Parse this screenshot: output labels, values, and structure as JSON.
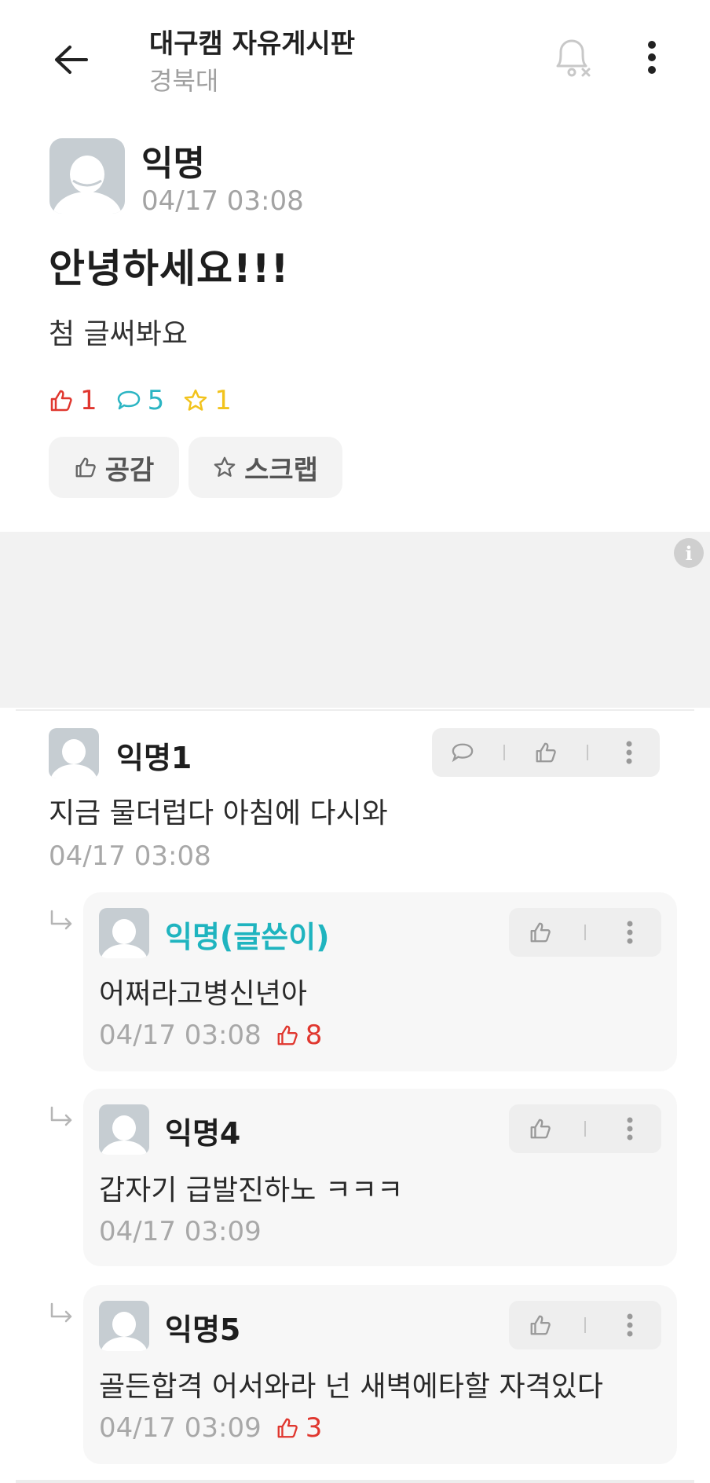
{
  "header": {
    "board_title": "대구캠 자유게시판",
    "school": "경북대"
  },
  "post": {
    "author": "익명",
    "time": "04/17 03:08",
    "title": "안녕하세요!!!",
    "body": "첨 글써봐요",
    "stats": {
      "likes": "1",
      "comments": "5",
      "scraps": "1"
    },
    "like_button_label": "공감",
    "scrap_button_label": "스크랩"
  },
  "comments": [
    {
      "author": "익명1",
      "text": "지금 물더럽다 아침에 다시와",
      "time": "04/17 03:08"
    }
  ],
  "replies": [
    {
      "author": "익명(글쓴이)",
      "text": "어쩌라고병신년아",
      "time": "04/17 03:08",
      "likes": "8"
    },
    {
      "author": "익명4",
      "text": "갑자기 급발진하노 ㅋㅋㅋ",
      "time": "04/17 03:09"
    },
    {
      "author": "익명5",
      "text": "골든합격 어서와라 넌 새벽에타할 자격있다",
      "time": "04/17 03:09",
      "likes": "3"
    }
  ],
  "colors": {
    "like_red": "#e0372f",
    "comment_teal": "#2bb5c3",
    "scrap_yellow": "#f2c31c",
    "op_author_teal": "#1fb4bf",
    "avatar_gray": "#c6cdd2"
  },
  "icons": [
    "back-arrow-icon",
    "bell-off-icon",
    "more-vertical-icon",
    "thumbs-up-icon",
    "speech-bubble-icon",
    "star-icon",
    "info-icon",
    "reply-arrow-icon"
  ]
}
